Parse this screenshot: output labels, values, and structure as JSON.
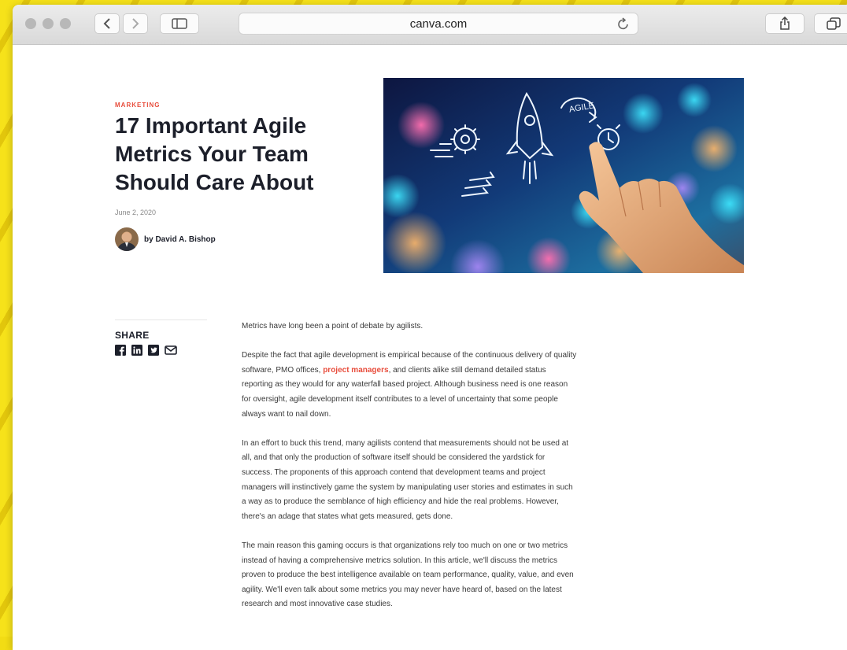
{
  "browser": {
    "url": "canva.com",
    "icons": {
      "back": "chevron-left-icon",
      "forward": "chevron-right-icon",
      "sidebar": "sidebar-icon",
      "reload": "reload-icon",
      "share": "share-icon",
      "tabs": "tabs-icon"
    }
  },
  "article": {
    "category": "MARKETING",
    "title": "17 Important Agile Metrics Your Team Should Care About",
    "date": "June 2, 2020",
    "author": "by David A. Bishop",
    "hero_label": "AGILE",
    "share_label": "SHARE",
    "share_icons": [
      "facebook-icon",
      "linkedin-icon",
      "twitter-icon",
      "email-icon"
    ],
    "paragraphs": {
      "p1": "Metrics have long been a point of debate by agilists.",
      "p2_before": "Despite the fact that agile development is empirical because of the continuous delivery of quality software, PMO offices, ",
      "p2_link": "project managers",
      "p2_after": ", and clients alike still demand detailed status reporting as they would for any waterfall based project. Although business need is one reason for oversight, agile development itself contributes to a level of uncertainty that some people always want to nail down.",
      "p3": "In an effort to buck this trend, many agilists contend that measurements should not be used at all, and that only the production of software itself should be considered the yardstick for success. The proponents of this approach contend that development teams and project managers will instinctively game the system by manipulating user stories and estimates in such a way as to produce the semblance of high efficiency and hide the real problems. However, there's an adage that states what gets measured, gets done.",
      "p4": "The main reason this gaming occurs is that organizations rely too much on one or two metrics instead of having a comprehensive metrics solution. In this article, we'll discuss the metrics proven to produce the best intelligence available on team performance, quality, value, and even agility. We'll even talk about some metrics you may never have heard of, based on the latest research and most innovative case studies."
    }
  },
  "colors": {
    "accent": "#e84d3c",
    "heading": "#1c1f2a",
    "background": "#f2dc14"
  }
}
